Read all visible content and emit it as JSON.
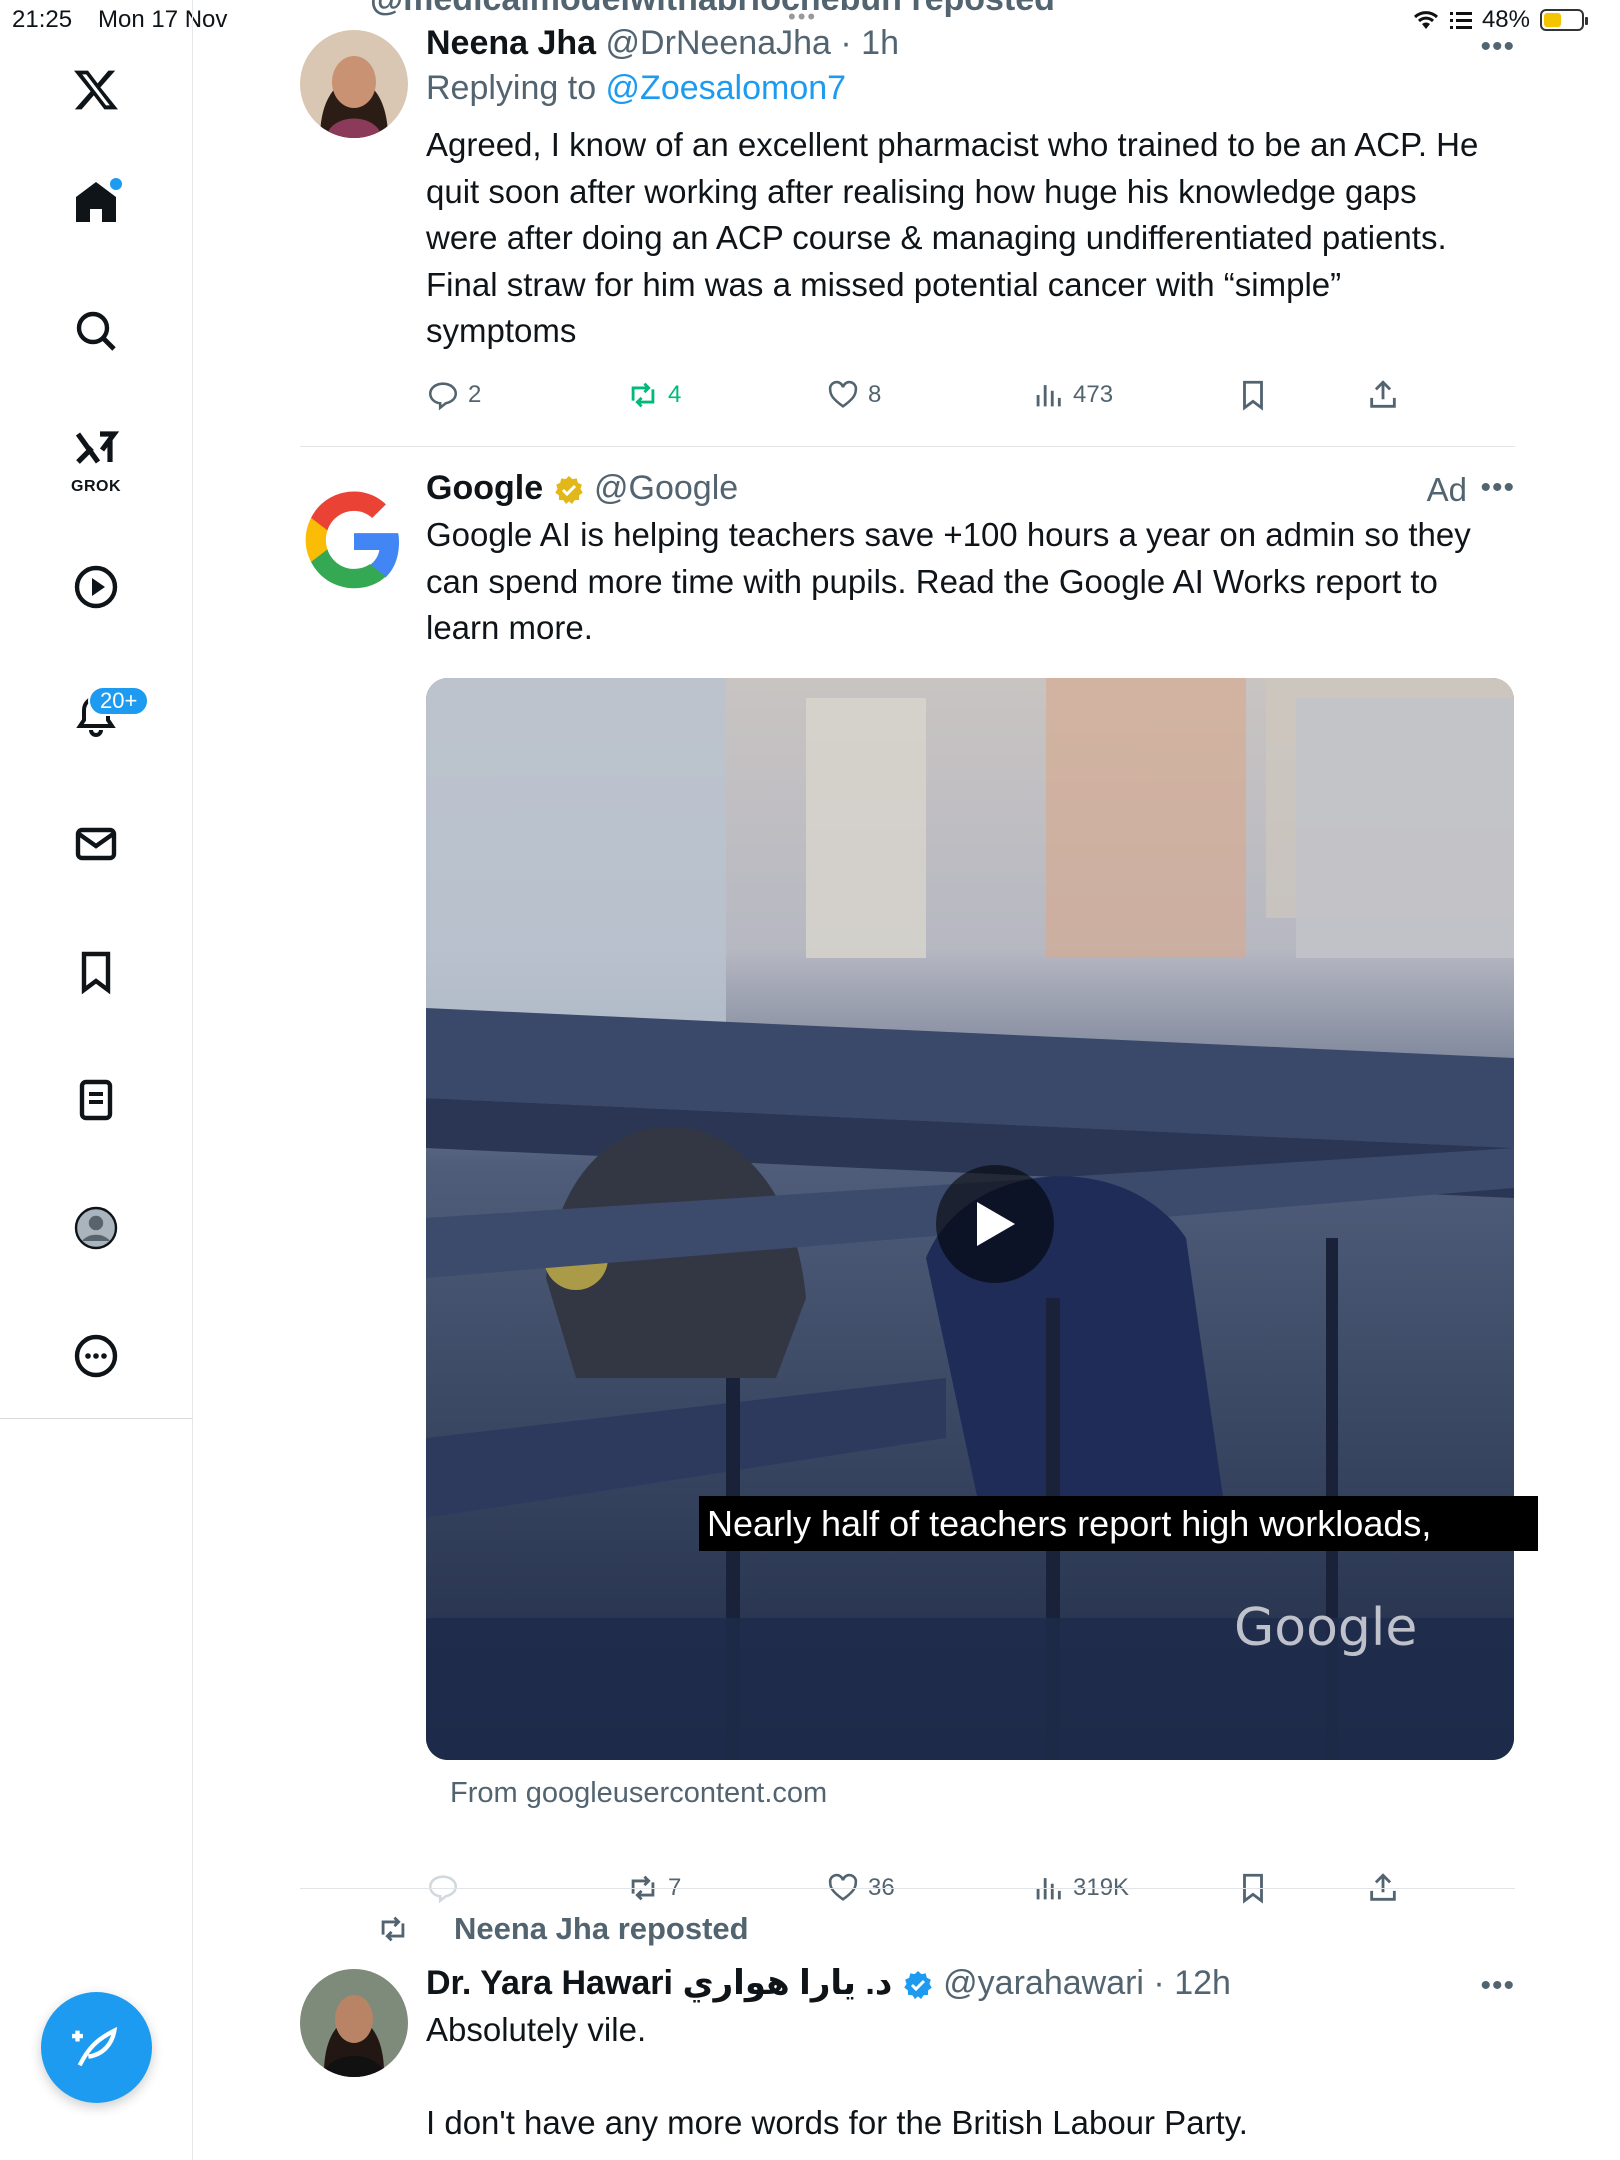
{
  "status_bar": {
    "time": "21:25",
    "date": "Mon 17 Nov",
    "battery": "48%",
    "battery_level": 0.48
  },
  "sidebar": {
    "grok_label": "GROK",
    "notifications_badge": "20+"
  },
  "header_fragment": "@medicalmodelwithabriochebun reposted",
  "posts": [
    {
      "name": "Neena Jha",
      "handle": "@DrNeenaJha",
      "time": "1h",
      "replying_prefix": "Replying to ",
      "replying_to": "@Zoesalomon7",
      "text_lines": [
        "Agreed, I know of an excellent pharmacist who trained to be an ACP. He",
        "quit soon after working after realising how huge his knowledge gaps",
        "were after doing an ACP course & managing undifferentiated patients.",
        "Final straw for him was a missed potential cancer with “simple”",
        "symptoms"
      ],
      "replies": "2",
      "reposts": "4",
      "likes": "8",
      "views": "473"
    },
    {
      "name": "Google",
      "handle": "@Google",
      "ad_label": "Ad",
      "text_lines": [
        "Google AI is helping teachers save +100 hours a year on admin so they",
        "can spend more time with pupils. Read the Google AI Works report to",
        "learn more."
      ],
      "video_caption": "Nearly half of teachers report high workloads,",
      "video_watermark": "Google",
      "source": "From googleusercontent.com",
      "reposts": "7",
      "likes": "36",
      "views": "319K"
    },
    {
      "reposted_by": "Neena Jha reposted",
      "name": "Dr. Yara Hawari د. يارا هواري",
      "handle": "@yarahawari",
      "time": "12h",
      "text_line1": "Absolutely vile.",
      "text_line2": "I don't have any more words for the British Labour Party."
    }
  ],
  "colors": {
    "accent": "#1d9bf0",
    "repost_green": "#00ba7c",
    "secondary_text": "#536471",
    "gold_badge": "#e2b719"
  }
}
